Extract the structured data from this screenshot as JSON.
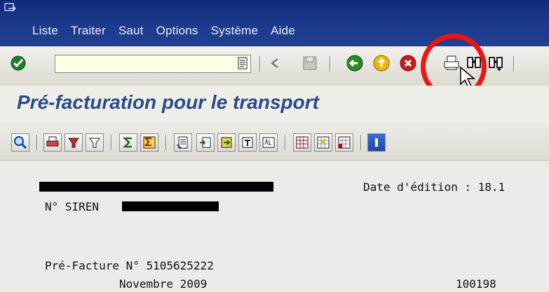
{
  "menu": {
    "items": [
      "Liste",
      "Traiter",
      "Saut",
      "Options",
      "Système",
      "Aide"
    ]
  },
  "toolbar": {
    "command_value": "",
    "icons": [
      "enter-check-icon",
      "command-doc-icon",
      "back-arrow-icon",
      "save-icon",
      "back-icon",
      "exit-icon",
      "cancel-icon",
      "print-icon",
      "find-icon",
      "find-next-icon"
    ]
  },
  "page": {
    "title": "Pré-facturation pour le transport"
  },
  "report": {
    "date_label": "Date d'édition : 18.1",
    "siren_label": "N° SIREN",
    "invoice_label": "Pré-Facture N° 5105625222",
    "period": "Novembre 2009",
    "code": "100198"
  },
  "colors": {
    "menubar": "#1d3a8c",
    "title": "#284b8c",
    "annotation": "#f01410",
    "command_bg": "#ffffe6"
  }
}
